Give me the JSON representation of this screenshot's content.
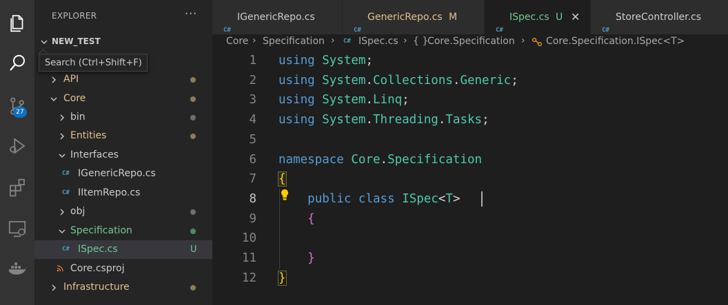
{
  "activity_bar": {
    "items": [
      {
        "name": "explorer-icon"
      },
      {
        "name": "search-icon"
      },
      {
        "name": "source-control-icon",
        "badge": "27"
      },
      {
        "name": "run-debug-icon"
      },
      {
        "name": "extensions-icon"
      },
      {
        "name": "remote-explorer-icon"
      },
      {
        "name": "docker-icon"
      }
    ]
  },
  "tooltip": {
    "text": "Search (Ctrl+Shift+F)"
  },
  "sidebar": {
    "title": "EXPLORER",
    "more": "···",
    "root": "NEW_TEST",
    "tree": [
      {
        "label": "API",
        "expanded": false,
        "color": "#e2c08d",
        "indicator": "dot",
        "indicator_color": "#8c7c5c"
      },
      {
        "label": "Core",
        "expanded": true,
        "color": "#e2c08d",
        "indicator": "dot",
        "indicator_color": "#8c7c5c"
      },
      {
        "label": "bin",
        "expanded": false,
        "color": "#cccccc",
        "indicator": "dot",
        "indicator_color": "#6e6e6e"
      },
      {
        "label": "Entities",
        "expanded": false,
        "color": "#e2c08d",
        "indicator": "dot",
        "indicator_color": "#8c7c5c"
      },
      {
        "label": "Interfaces",
        "expanded": true,
        "color": "#cccccc"
      },
      {
        "label": "IGenericRepo.cs",
        "file": "cs",
        "color": "#cccccc"
      },
      {
        "label": "IItemRepo.cs",
        "file": "cs",
        "color": "#cccccc"
      },
      {
        "label": "obj",
        "expanded": false,
        "color": "#cccccc",
        "indicator": "dot",
        "indicator_color": "#6e6e6e"
      },
      {
        "label": "Specification",
        "expanded": true,
        "color": "#73c991",
        "indicator": "dot",
        "indicator_color": "#4f8a63"
      },
      {
        "label": "ISpec.cs",
        "file": "cs",
        "color": "#73c991",
        "indicator": "U",
        "indicator_color": "#73c991",
        "selected": true
      },
      {
        "label": "Core.csproj",
        "file": "rss",
        "color": "#cccccc"
      },
      {
        "label": "Infrastructure",
        "expanded": false,
        "color": "#e2c08d",
        "indicator": "dot",
        "indicator_color": "#8c7c5c"
      }
    ]
  },
  "tabs": [
    {
      "label": "IGenericRepo.cs",
      "active": false,
      "color": "#cccccc",
      "suffix": ""
    },
    {
      "label": "GenericRepo.cs",
      "active": false,
      "color": "#e2c08d",
      "suffix": "M"
    },
    {
      "label": "ISpec.cs",
      "active": true,
      "color": "#73c991",
      "suffix": "U",
      "close": "✕"
    },
    {
      "label": "StoreController.cs",
      "active": false,
      "color": "#cccccc",
      "suffix": ""
    }
  ],
  "breadcrumb": [
    "Core",
    "Specification",
    "ISpec.cs",
    "Core.Specification",
    "Core.Specification.ISpec<T>"
  ],
  "breadcrumb_icons": {
    "namespace": "{ }"
  },
  "editor": {
    "line_numbers": [
      "1",
      "2",
      "3",
      "4",
      "5",
      "6",
      "7",
      "8",
      "9",
      "10",
      "11",
      "12"
    ],
    "current_line": 8
  }
}
